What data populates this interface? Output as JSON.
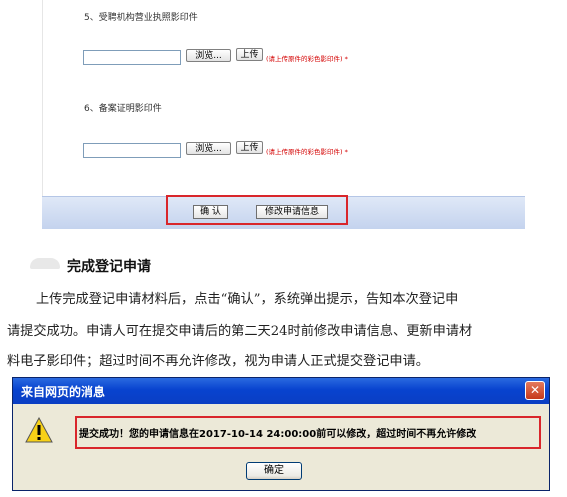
{
  "form": {
    "section5_label": "5、受聘机构营业执照影印件",
    "section6_label": "6、备案证明影印件",
    "browse_label": "浏览...",
    "upload_label": "上传",
    "upload_hint": "(请上传原件的彩色影印件) *",
    "confirm_label": "确 认",
    "modify_label": "修改申请信息"
  },
  "article": {
    "heading": "完成登记申请",
    "lines": [
      "上传完成登记申请材料后，点击“确认”，系统弹出提示，告知本次登记申",
      "请提交成功。申请人可在提交申请后的第二天24时前修改申请信息、更新申请材",
      "料电子影印件；超过时间不再允许修改，视为申请人正式提交登记申请。"
    ]
  },
  "dialog": {
    "title": "来自网页的消息",
    "message": "提交成功！您的申请信息在2017-10-14 24:00:00前可以修改，超过时间不再允许修改",
    "ok_label": "确定"
  },
  "colors": {
    "highlight_red": "#d9262b",
    "titlebar_blue": "#0843cf"
  }
}
